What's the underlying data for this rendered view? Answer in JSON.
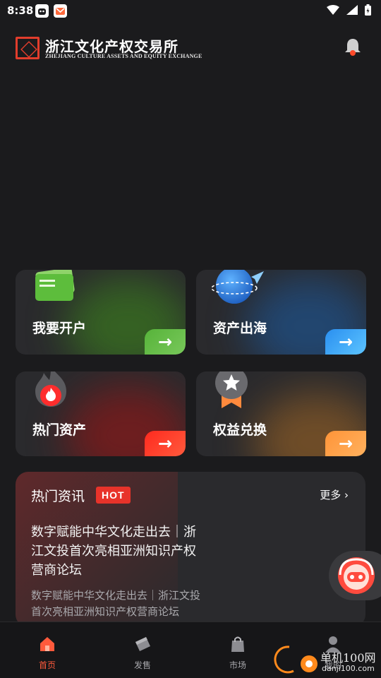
{
  "status_bar": {
    "time": "8:38",
    "icons": [
      "app-robot-icon",
      "app-mail-icon",
      "wifi-icon",
      "signal-icon",
      "battery-icon"
    ]
  },
  "header": {
    "title": "浙江文化产权交易所",
    "subtitle": "ZHEJIANG CULTURE ASSETS AND EQUITY EXCHANGE",
    "notification_icon": "bell-icon"
  },
  "cards": [
    {
      "label": "我要开户",
      "icon": "card-stack-icon",
      "accent": "#5fbf3a"
    },
    {
      "label": "资产出海",
      "icon": "globe-plane-icon",
      "accent": "#3aa7f5"
    },
    {
      "label": "热门资产",
      "icon": "flame-icon",
      "accent": "#ff3b30"
    },
    {
      "label": "权益兑换",
      "icon": "star-badge-icon",
      "accent": "#ff9f43"
    }
  ],
  "news": {
    "title": "热门资讯",
    "badge": "HOT",
    "more_label": "更多",
    "headline": "数字赋能中华文化走出去｜浙江文投首次亮相亚洲知识产权营商论坛",
    "summary": "数字赋能中华文化走出去｜浙江文投首次亮相亚洲知识产权营商论坛"
  },
  "support": {
    "icon": "customer-service-icon"
  },
  "bottom_nav": [
    {
      "label": "首页",
      "icon": "home-icon",
      "active": true
    },
    {
      "label": "发售",
      "icon": "ticket-icon",
      "active": false
    },
    {
      "label": "市场",
      "icon": "shopping-bag-icon",
      "active": false
    },
    {
      "label": "我的",
      "icon": "user-icon",
      "active": false
    }
  ],
  "colors": {
    "background": "#1b1b1d",
    "card": "#2a2a2d",
    "brand_red": "#e23d2c",
    "active_nav": "#ff5a3c"
  },
  "watermark": {
    "text": "单机100网",
    "sub": "danji100.com"
  }
}
